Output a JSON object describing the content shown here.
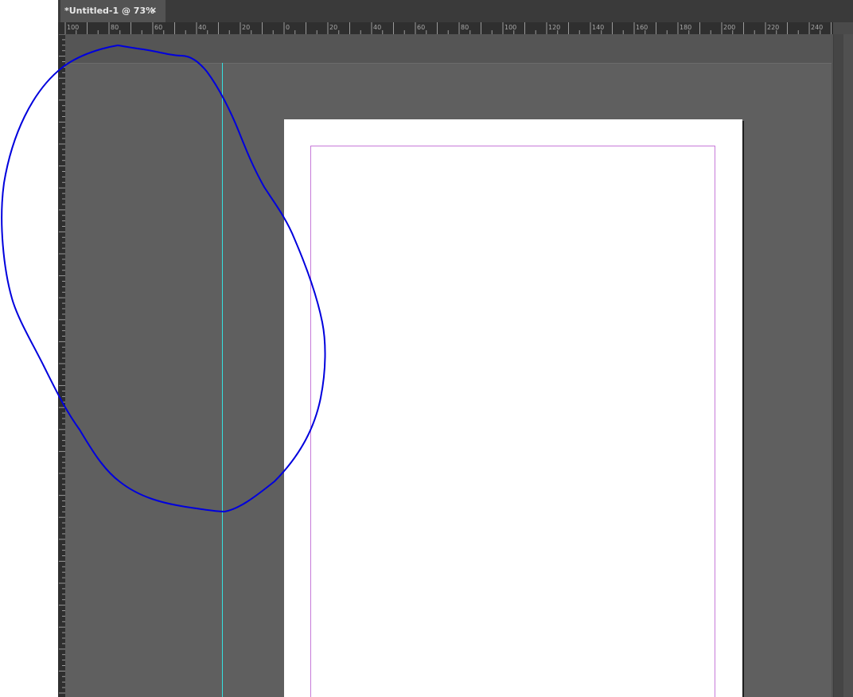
{
  "tab": {
    "title": "*Untitled-1 @ 73%",
    "close": "×"
  },
  "ruler": {
    "labels": [
      "100",
      "80",
      "60",
      "40",
      "20",
      "0",
      "20",
      "40",
      "60",
      "80",
      "100",
      "120",
      "140",
      "160",
      "180",
      "200",
      "220",
      "240"
    ]
  },
  "colors": {
    "guide": "#35e0e0",
    "margin": "#c77ad9",
    "annotation": "#0000dd"
  }
}
